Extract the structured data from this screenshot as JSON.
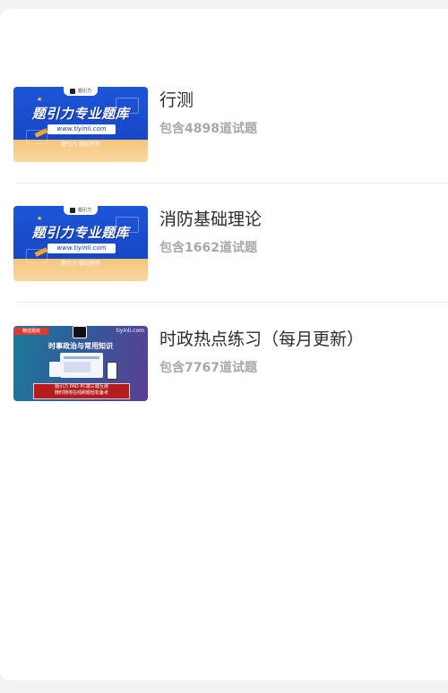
{
  "items": [
    {
      "title": "行测",
      "count": "包含4898道试题",
      "thumb": {
        "headline": "题引力专业题库",
        "url": "www.tiyinli.com",
        "subline": "题引力 版权所有",
        "brand": "题引力"
      }
    },
    {
      "title": "消防基础理论",
      "count": "包含1662道试题",
      "thumb": {
        "headline": "题引力专业题库",
        "url": "www.tiyinli.com",
        "subline": "题引力 版权所有",
        "brand": "题引力"
      }
    },
    {
      "title": "时政热点练习（每月更新）",
      "count": "包含7767道试题",
      "thumb": {
        "tag": "精选题库",
        "site": "tiyinli.com",
        "headline": "时事政治与常用知识",
        "bottom_line1": "题引力   PAD   PC端三端互通",
        "bottom_line2": "随时随地在线刷题轻松备考"
      }
    }
  ]
}
